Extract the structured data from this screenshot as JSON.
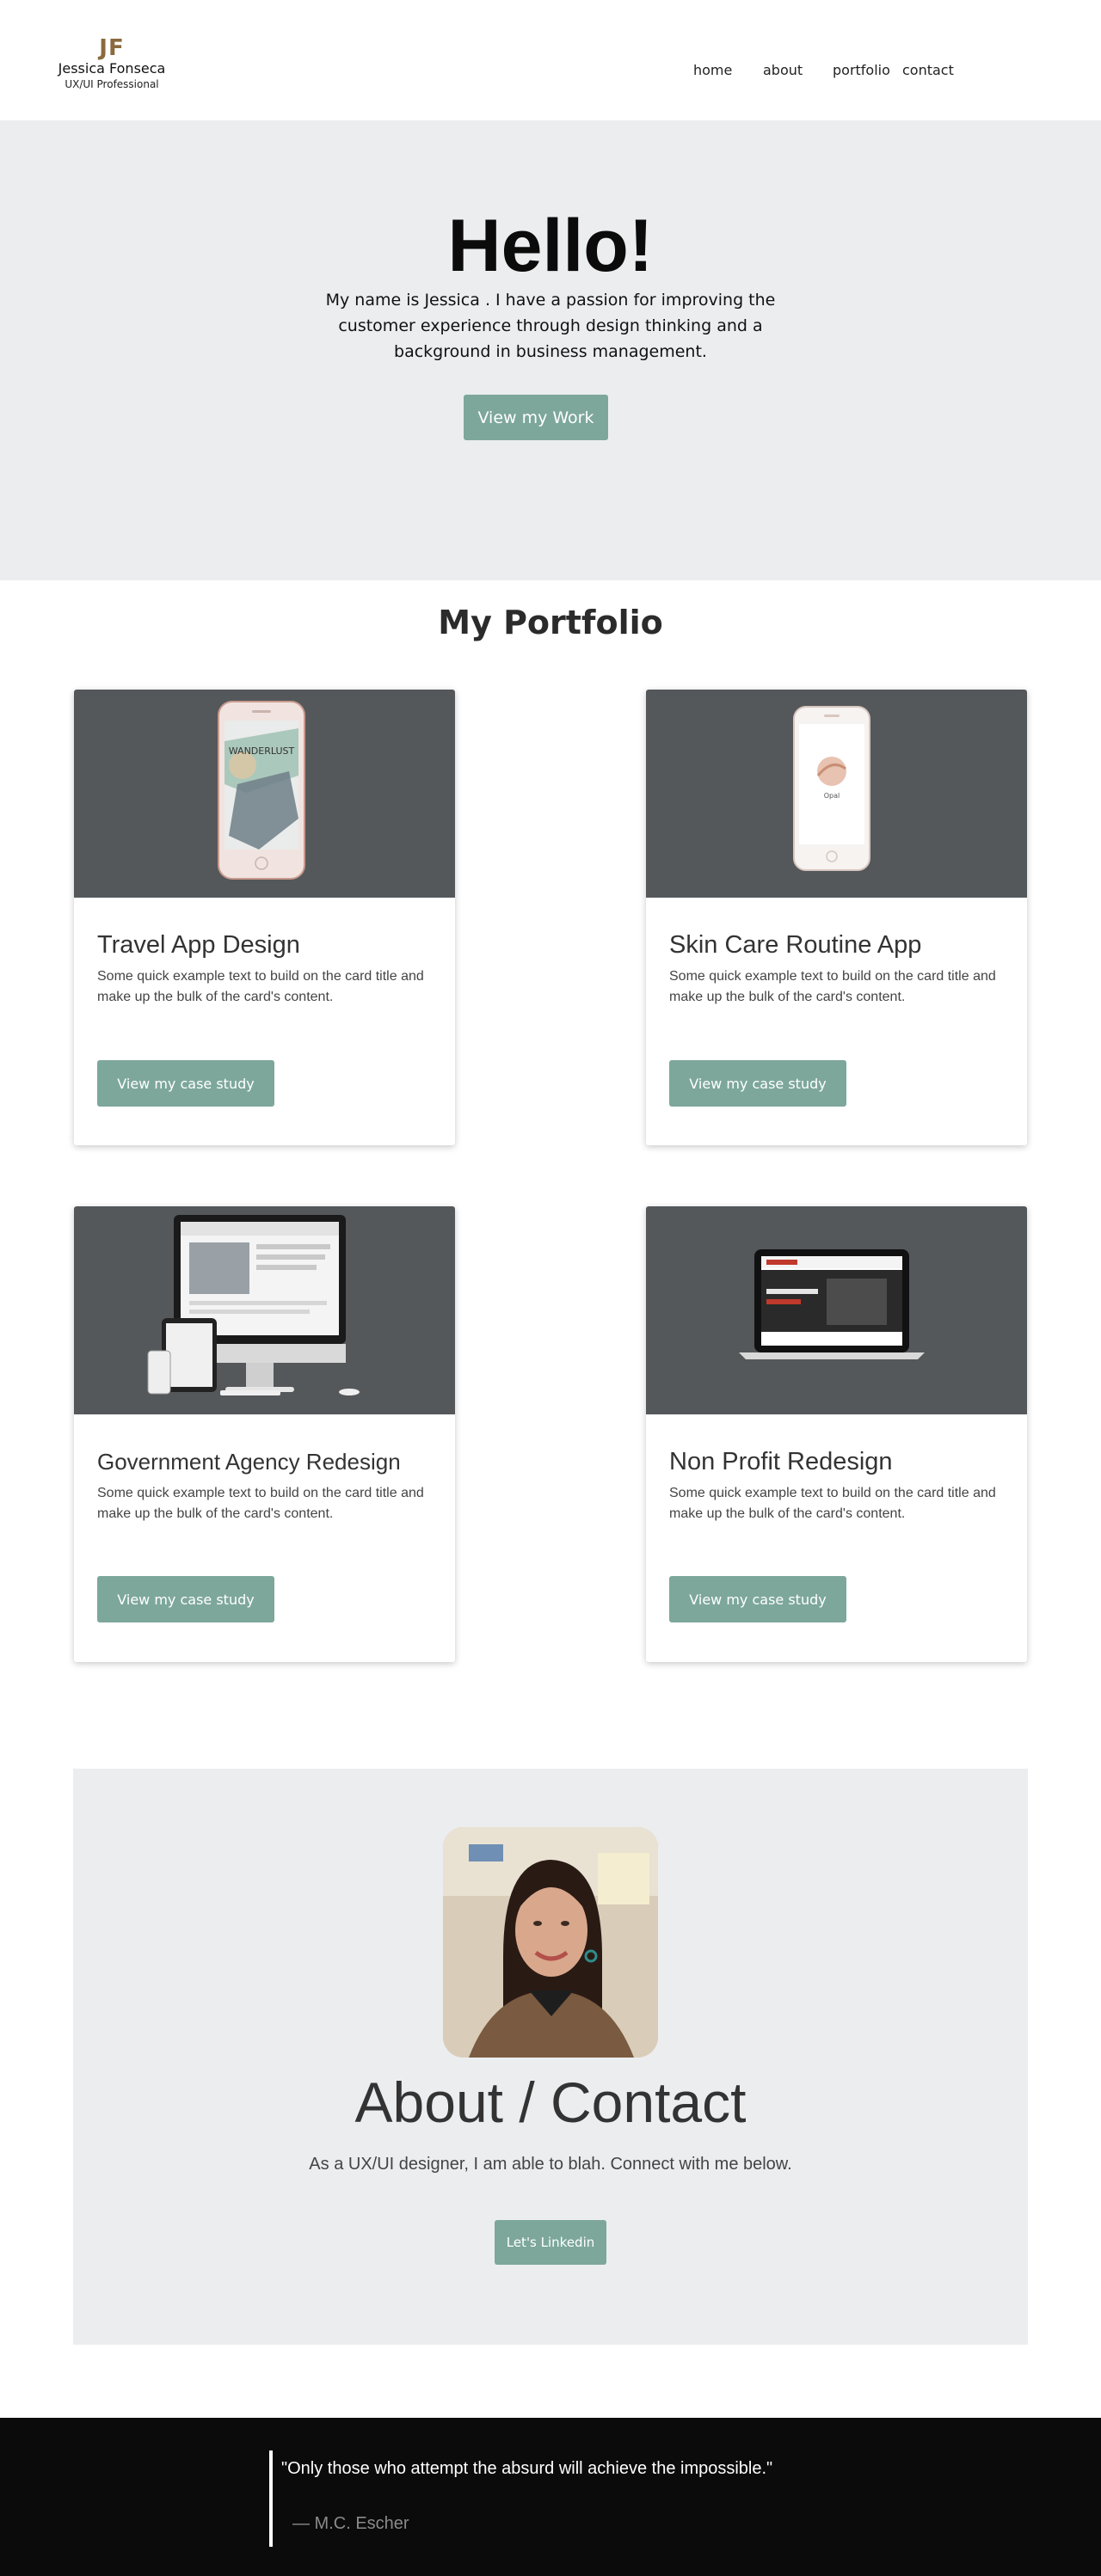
{
  "brand": {
    "monogram": "JF",
    "name": "Jessica Fonseca",
    "role": "UX/UI Professional"
  },
  "nav": {
    "items": [
      "home",
      "about",
      "portfolio",
      "contact"
    ]
  },
  "hero": {
    "title": "Hello!",
    "text": "My name is Jessica . I have a passion for improving the customer experience through design thinking and a background in business management.",
    "button": "View my Work"
  },
  "portfolio": {
    "title": "My Portfolio",
    "cards": [
      {
        "title": "Travel App Design",
        "text": "Some quick example text to build on the card title and make up the bulk of the card's content.",
        "button": "View my case study",
        "image": "phone-mockup-wanderlust",
        "screen_label": "WANDERLUST"
      },
      {
        "title": "Skin Care Routine App",
        "text": "Some quick example text to build on the card title and make up the bulk of the card's content.",
        "button": "View my case study",
        "image": "phone-mockup-skincare",
        "screen_label": "Opal"
      },
      {
        "title": "Government Agency Redesign",
        "text": "Some quick example text to build on the card title and make up the bulk of the card's content.",
        "button": "View my case study",
        "image": "desktop-mockup"
      },
      {
        "title": "Non Profit Redesign",
        "text": "Some quick example text to build on the card title and make up the bulk of the card's content.",
        "button": "View my case study",
        "image": "laptop-mockup"
      }
    ]
  },
  "about": {
    "title": "About / Contact",
    "text": "As a UX/UI designer, I  am able to blah. Connect with me below.",
    "button": "Let's Linkedin",
    "photo": "portrait-photo"
  },
  "footer": {
    "quote": "\"Only those who attempt the absurd will achieve the impossible.\"",
    "author": "— M.C. Escher"
  },
  "colors": {
    "accent": "#7da79b",
    "hero_bg": "#ecedef",
    "card_image_bg": "#54585b",
    "footer_bg": "#0b0b0b",
    "brand": "#8a6a3e"
  }
}
